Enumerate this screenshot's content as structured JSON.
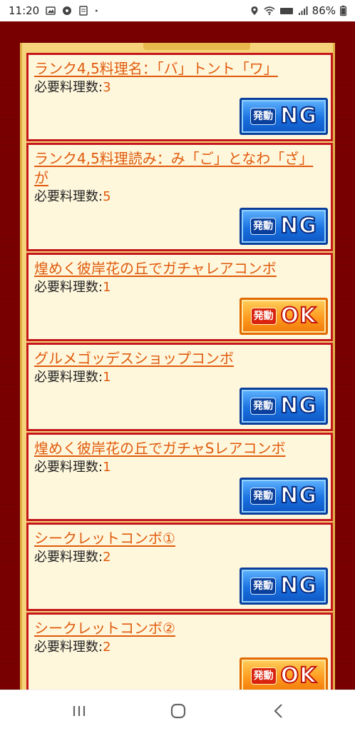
{
  "status_bar": {
    "time": "11:20",
    "battery": "86%"
  },
  "combos": [
    {
      "name": "ランク4,5料理名：「バ」トント「ワ」",
      "req_label": "必要料理数:",
      "req_value": "3",
      "status_prefix": "発動",
      "status_main": "NG",
      "status": "ng"
    },
    {
      "name": "ランク4,5料理読み：み「ご」となわ「ざ」が",
      "req_label": "必要料理数:",
      "req_value": "5",
      "status_prefix": "発動",
      "status_main": "NG",
      "status": "ng"
    },
    {
      "name": "煌めく彼岸花の丘でガチャレアコンボ",
      "req_label": "必要料理数:",
      "req_value": "1",
      "status_prefix": "発動",
      "status_main": "OK",
      "status": "ok"
    },
    {
      "name": "グルメゴッデスショップコンボ",
      "req_label": "必要料理数:",
      "req_value": "1",
      "status_prefix": "発動",
      "status_main": "NG",
      "status": "ng"
    },
    {
      "name": "煌めく彼岸花の丘でガチャSレアコンボ",
      "req_label": "必要料理数:",
      "req_value": "1",
      "status_prefix": "発動",
      "status_main": "NG",
      "status": "ng"
    },
    {
      "name": "シークレットコンボ①",
      "req_label": "必要料理数:",
      "req_value": "2",
      "status_prefix": "発動",
      "status_main": "NG",
      "status": "ng"
    },
    {
      "name": "シークレットコンボ②",
      "req_label": "必要料理数:",
      "req_value": "2",
      "status_prefix": "発動",
      "status_main": "OK",
      "status": "ok"
    }
  ],
  "colors": {
    "background": "#7a0000",
    "card_border": "#c4161c",
    "link": "#e05a0c",
    "ng_button": "#1a72e0",
    "ok_button": "#ff9a1e"
  },
  "icons": {
    "status_left": [
      "image-icon",
      "soccer-ball-icon",
      "app-notification-icon",
      "dot-icon"
    ],
    "status_right": [
      "location-icon",
      "wifi-icon",
      "volte-icon",
      "signal-icon"
    ],
    "nav": [
      "recent-apps-icon",
      "home-icon",
      "back-icon"
    ]
  }
}
